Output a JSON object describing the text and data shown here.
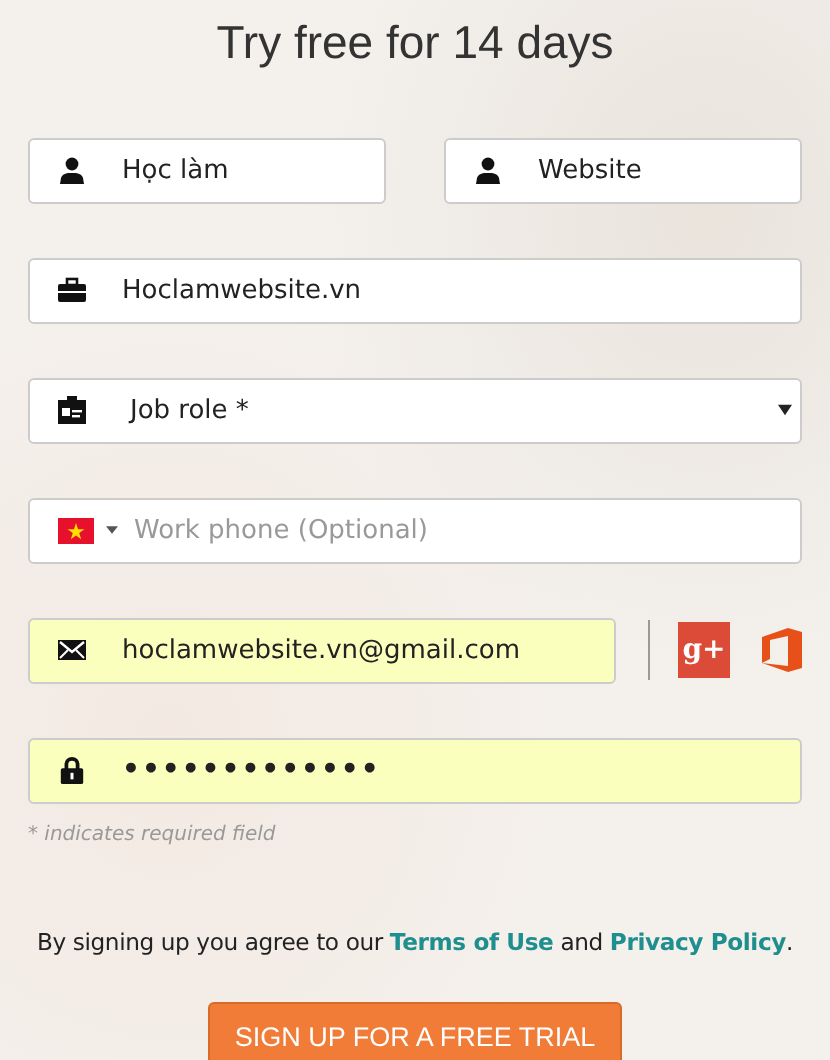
{
  "title": "Try free for 14 days",
  "name_row": [
    {
      "value": "Học làm"
    },
    {
      "value": "Website"
    }
  ],
  "fields": [
    {
      "kind": "text",
      "value": "Hoclamwebsite.vn",
      "autofilled": false
    },
    {
      "kind": "select",
      "value": "Job role *",
      "autofilled": false
    },
    {
      "kind": "phone",
      "placeholder": "Work phone (Optional)",
      "autofilled": false
    },
    {
      "kind": "email",
      "value": "hoclamwebsite.vn@gmail.com",
      "autofilled": true
    },
    {
      "kind": "password",
      "value": "•••••••••••••",
      "autofilled": true
    }
  ],
  "social": [
    {
      "kind": "google",
      "label": "g+"
    },
    {
      "kind": "office"
    }
  ],
  "required_note": "* indicates required field",
  "agreement": [
    {
      "kind": "text",
      "text": "By signing up you agree to our "
    },
    {
      "kind": "link",
      "text": "Terms of Use"
    },
    {
      "kind": "text",
      "text": " and "
    },
    {
      "kind": "link",
      "text": "Privacy Policy"
    },
    {
      "kind": "text",
      "text": "."
    }
  ],
  "submit": "SIGN UP FOR A FREE TRIAL"
}
